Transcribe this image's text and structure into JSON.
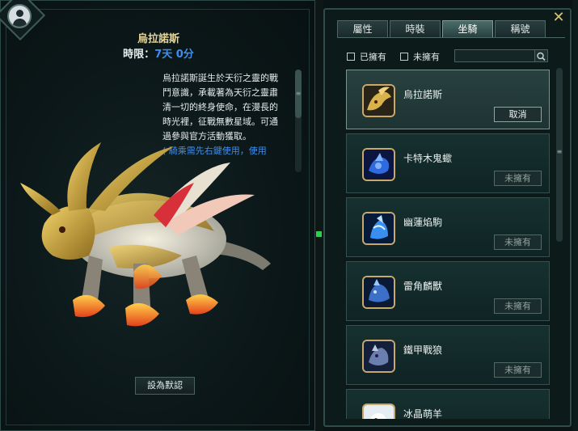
{
  "mount_detail": {
    "title": "烏拉諾斯",
    "time_label": "時限：",
    "time_value": "7天 0分",
    "description": "烏拉諾斯誕生於天衍之靈的戰鬥意識，承載著為天衍之靈肅清一切的終身使命，在漫長的時光裡，征戰無數星域。可通過參與官方活動獲取。",
    "hint": "( 騎乘需先右鍵使用，使用",
    "set_default_label": "設為默認"
  },
  "tabs": [
    {
      "label": "屬性"
    },
    {
      "label": "時裝"
    },
    {
      "label": "坐騎"
    },
    {
      "label": "稱號"
    }
  ],
  "active_tab": "坐騎",
  "filters": {
    "owned_label": "已擁有",
    "not_owned_label": "未擁有",
    "search_placeholder": ""
  },
  "mounts": [
    {
      "name": "烏拉諾斯",
      "action": "取消",
      "status": "equipped"
    },
    {
      "name": "卡特木鬼蠍",
      "action": "未擁有",
      "status": "not-owned"
    },
    {
      "name": "幽蓮焰駒",
      "action": "未擁有",
      "status": "not-owned"
    },
    {
      "name": "雷角麟獸",
      "action": "未擁有",
      "status": "not-owned"
    },
    {
      "name": "鐵甲戰狼",
      "action": "未擁有",
      "status": "not-owned"
    },
    {
      "name": "冰晶萌羊",
      "action": "",
      "status": "not-owned"
    }
  ],
  "icons": {
    "close": "close-icon",
    "search": "search-icon",
    "avatar": "avatar-icon"
  },
  "colors": {
    "accent_gold": "#e8d79a",
    "time_blue": "#3e8ef0",
    "panel_bg": "#0d1a1a",
    "indicator_green": "#2fd14a"
  }
}
